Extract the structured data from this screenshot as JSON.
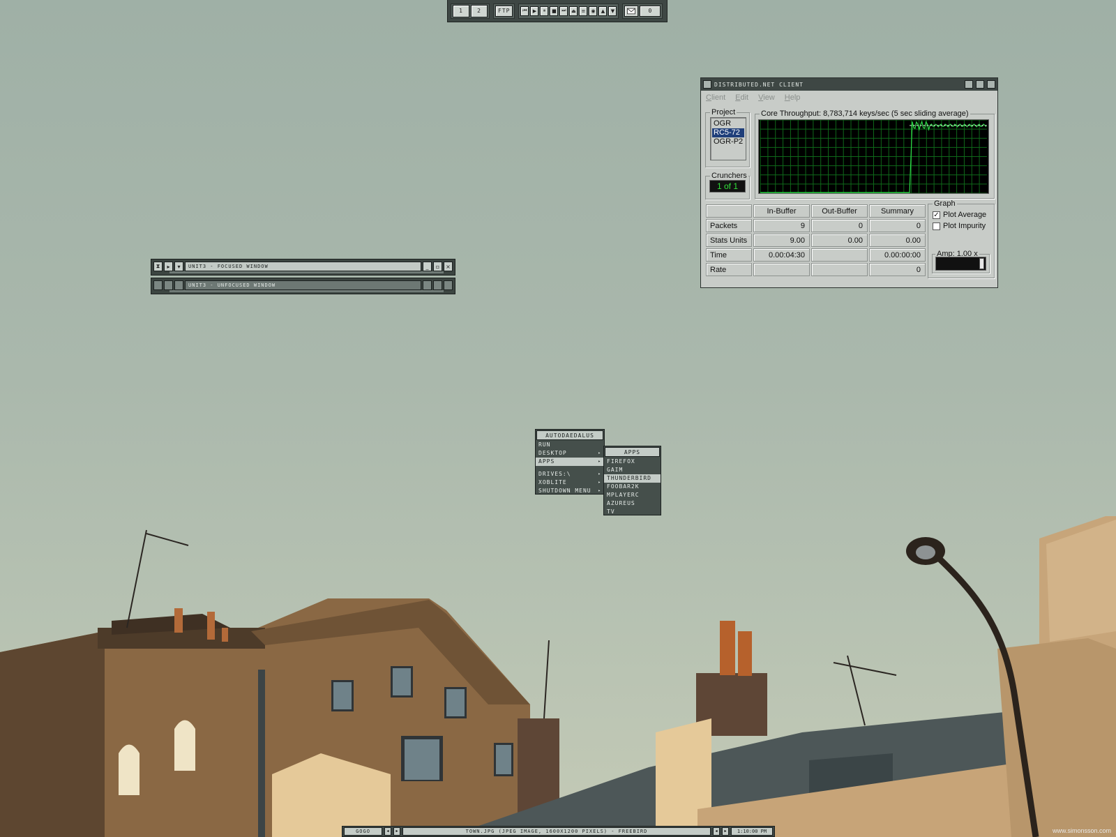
{
  "top_toolbar": {
    "workspaces": [
      "1",
      "2"
    ],
    "ftp_label": "FTP",
    "media_buttons": [
      "⏮",
      "▶",
      "⏸",
      "■",
      "⏭",
      "⏏",
      "≡",
      "◉",
      "▲",
      "▼"
    ],
    "mail_count": "0"
  },
  "focused_window": {
    "title": "unit3 - focused window"
  },
  "unfocused_window": {
    "title": "unit3 - unfocused window"
  },
  "dnet": {
    "title": "distributed.net client",
    "menu": [
      "Client",
      "Edit",
      "View",
      "Help"
    ],
    "project_label": "Project",
    "projects": [
      "OGR",
      "RC5-72",
      "OGR-P2"
    ],
    "selected_project": "RC5-72",
    "crunchers_label": "Crunchers",
    "crunchers_value": "1 of 1",
    "throughput_label": "Core Throughput: 8,783,714 keys/sec (5 sec sliding average)",
    "table": {
      "headers": [
        "In-Buffer",
        "Out-Buffer",
        "Summary"
      ],
      "rows": [
        {
          "label": "Packets",
          "in": "9",
          "out": "0",
          "sum": "0"
        },
        {
          "label": "Stats Units",
          "in": "9.00",
          "out": "0.00",
          "sum": "0.00"
        },
        {
          "label": "Time",
          "in": "0.00:04:30",
          "out": "",
          "sum": "0.00:00:00"
        },
        {
          "label": "Rate",
          "in": "",
          "out": "",
          "sum": "0"
        }
      ]
    },
    "graph_label": "Graph",
    "plot_average": {
      "label": "Plot Average",
      "checked": true
    },
    "plot_impurity": {
      "label": "Plot Impurity",
      "checked": false
    },
    "amp_label": "Amp: 1.00 x",
    "colors": {
      "graph_bg": "#000000",
      "grid": "#0f6a1a",
      "line": "#2fe04a",
      "avg": "#d8f4d8"
    }
  },
  "menu_main": {
    "title": "autoDaedalus",
    "items": [
      {
        "label": "Run",
        "submenu": false
      },
      {
        "label": "Desktop",
        "submenu": true
      },
      {
        "label": "Apps",
        "submenu": true,
        "active": true
      },
      {
        "label": "Drives:\\",
        "submenu": true
      },
      {
        "label": "xoblite",
        "submenu": true
      },
      {
        "label": "Shutdown Menu",
        "submenu": true
      }
    ]
  },
  "menu_apps": {
    "title": "Apps",
    "items": [
      "Firefox",
      "Gaim",
      "Thunderbird",
      "Foobar2k",
      "MPlayerC",
      "Azureus",
      "TV"
    ],
    "active": "Thunderbird"
  },
  "taskbar": {
    "workspace": "GoGo",
    "task": "town.jpg (JPEG Image, 1600x1200 pixels) - Freebird",
    "clock": "1:10:00 PM"
  },
  "credit": "www.simonsson.com",
  "icons": {
    "mail": "mail-icon",
    "arrow_left": "◂",
    "arrow_right": "▸",
    "submenu": "▸"
  }
}
